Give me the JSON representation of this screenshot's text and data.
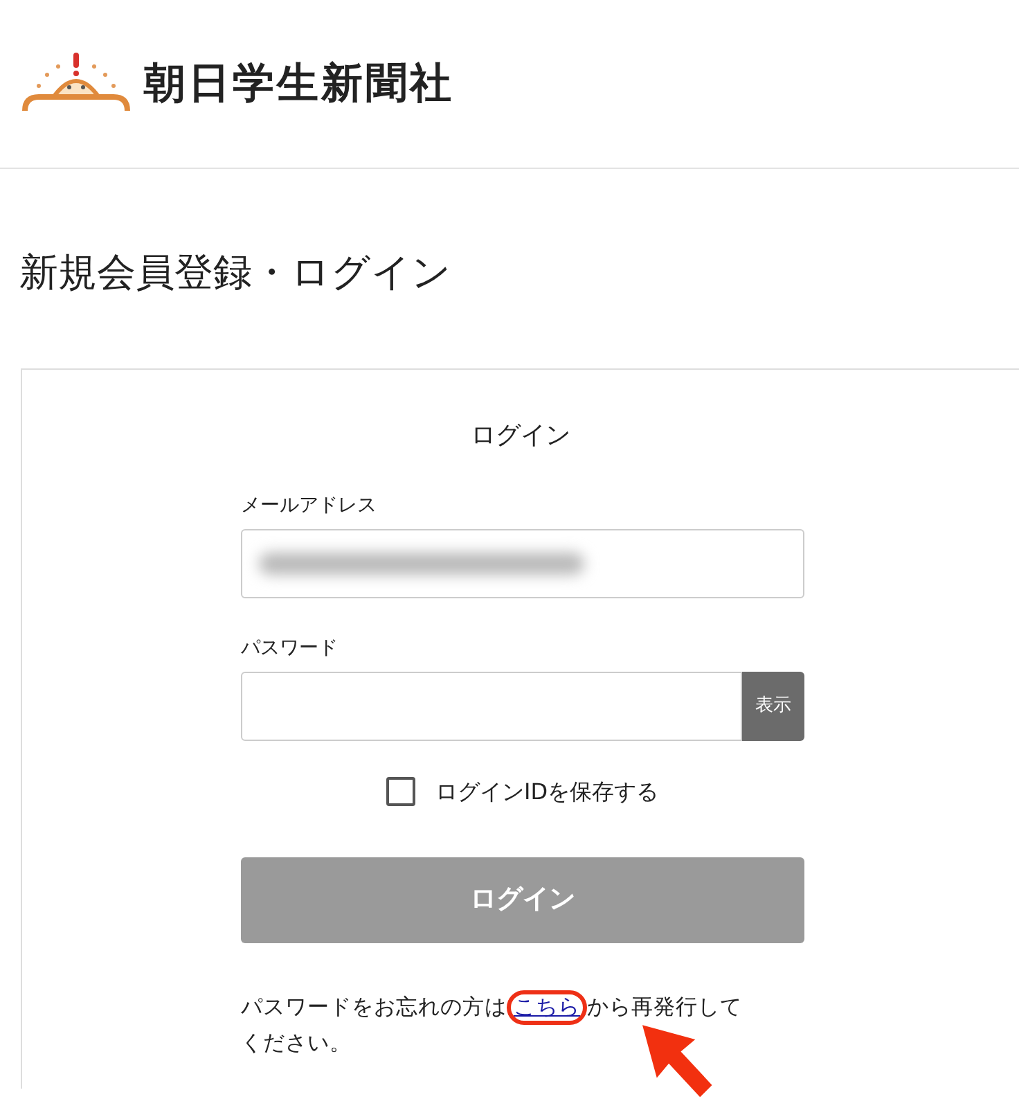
{
  "header": {
    "logo_text": "朝日学生新聞社"
  },
  "page_title": "新規会員登録・ログイン",
  "login": {
    "heading": "ログイン",
    "email": {
      "label": "メールアドレス",
      "value_redacted": true
    },
    "password": {
      "label": "パスワード",
      "toggle": "表示"
    },
    "remember": {
      "label": "ログインIDを保存する",
      "checked": false
    },
    "submit": {
      "label": "ログイン",
      "disabled": true
    },
    "forgot": {
      "before": "パスワードをお忘れの方は",
      "link": "こちら",
      "after": "から再発行してください。"
    }
  },
  "annotations": {
    "link_circle": true,
    "arrow": true
  }
}
